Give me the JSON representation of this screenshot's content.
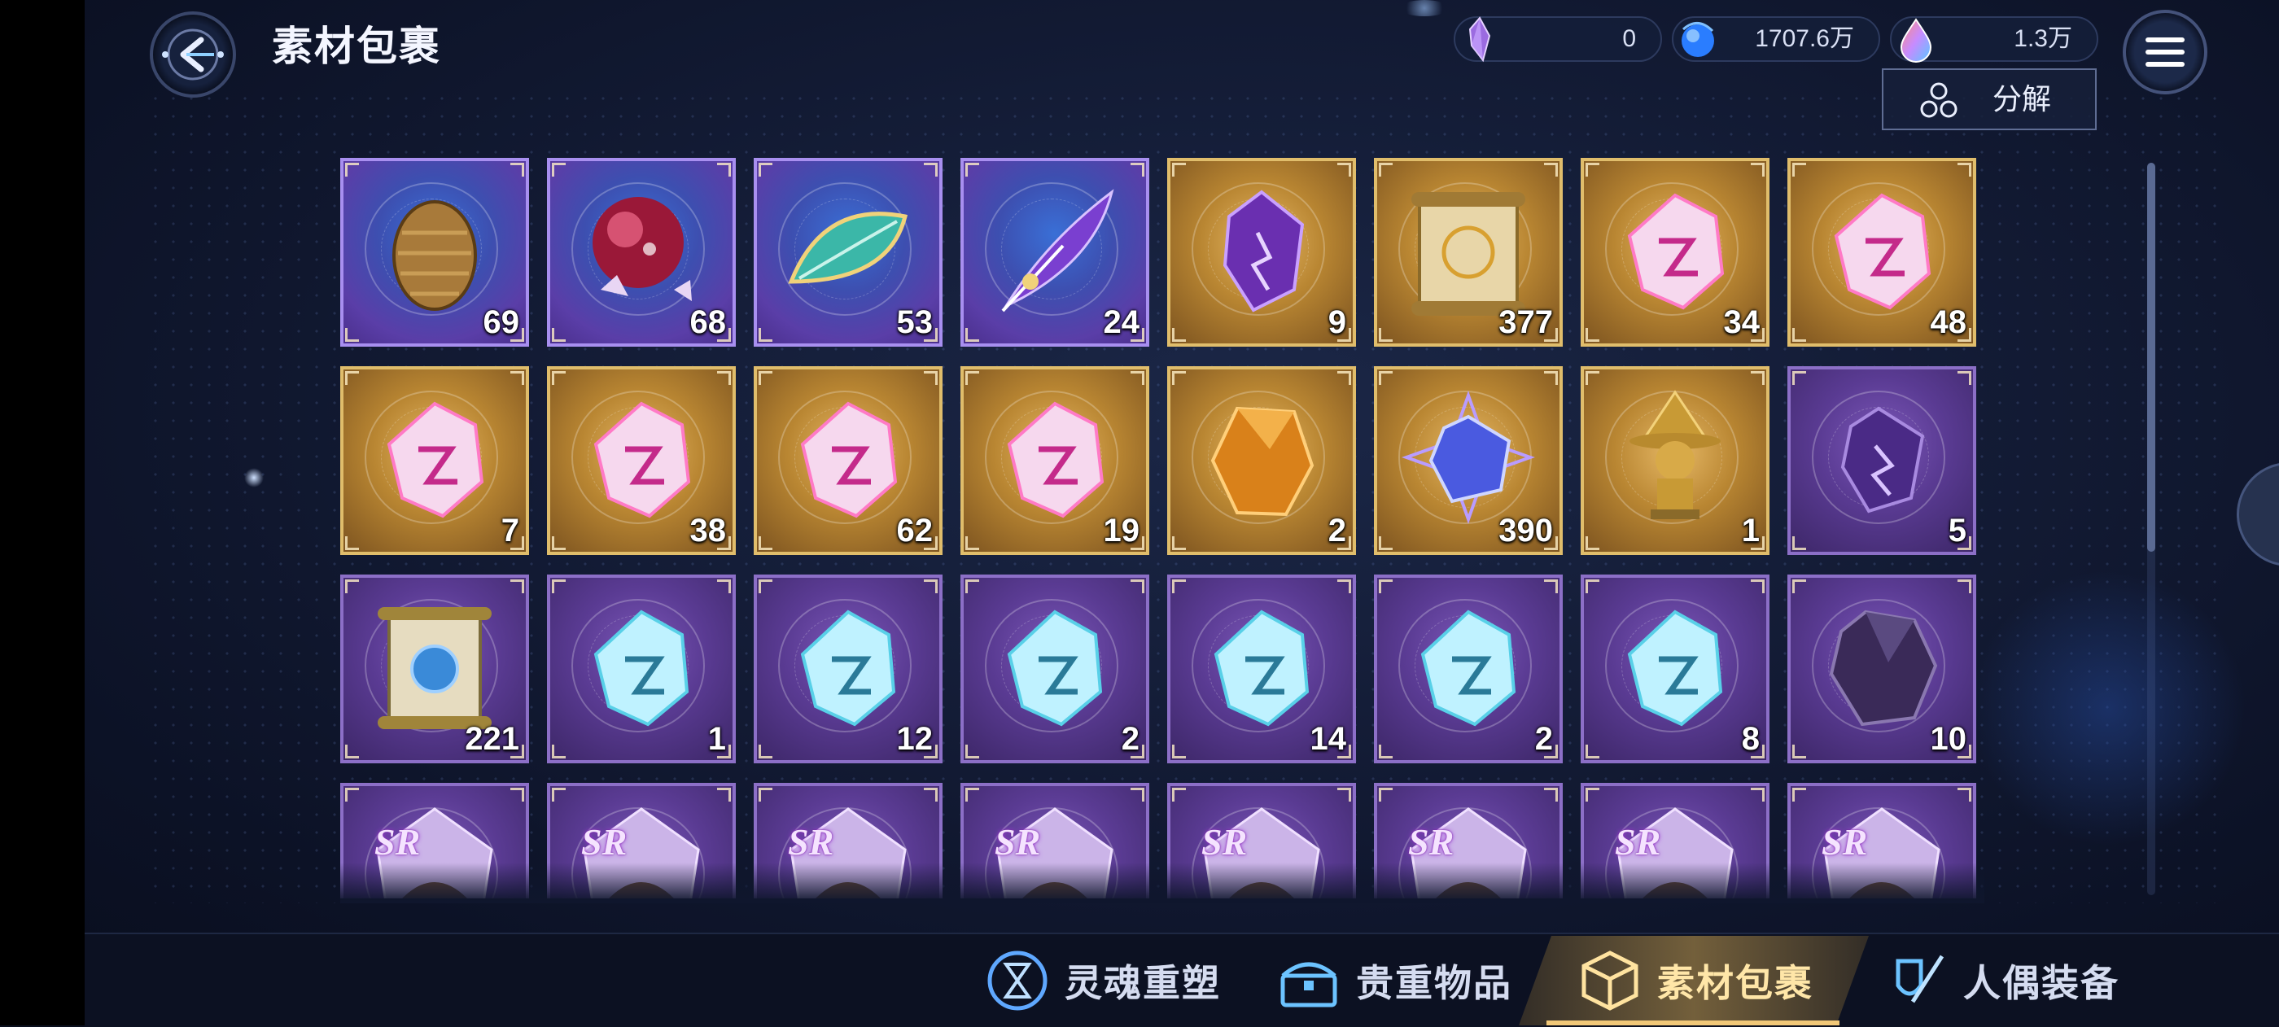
{
  "header": {
    "title": "素材包裹",
    "back_icon": "back-arrow-icon",
    "menu_icon": "hamburger-menu-icon"
  },
  "currencies": [
    {
      "name": "crystal",
      "icon": "purple-crystal-icon",
      "value": "0"
    },
    {
      "name": "blue-orb",
      "icon": "blue-orb-icon",
      "value": "1707.6万"
    },
    {
      "name": "rainbow-drop",
      "icon": "rainbow-drop-icon",
      "value": "1.3万"
    }
  ],
  "decompose_button": {
    "label": "分解",
    "icon": "decompose-icon"
  },
  "items": [
    {
      "icon": "golden-egg-icon",
      "rarity": "blue",
      "count": "69"
    },
    {
      "icon": "red-nebula-orb-icon",
      "rarity": "blue",
      "count": "68"
    },
    {
      "icon": "teal-feather-leaf-icon",
      "rarity": "blue",
      "count": "53"
    },
    {
      "icon": "purple-quill-icon",
      "rarity": "blue",
      "count": "24"
    },
    {
      "icon": "purple-crystal-shard-icon",
      "rarity": "gold",
      "count": "9"
    },
    {
      "icon": "golden-scroll-icon",
      "rarity": "gold",
      "count": "377"
    },
    {
      "icon": "pink-rune-stone-icon",
      "rarity": "gold",
      "count": "34"
    },
    {
      "icon": "pink-rune-stone-icon",
      "rarity": "gold",
      "count": "48"
    },
    {
      "icon": "pink-rune-stone-icon",
      "rarity": "gold",
      "count": "7"
    },
    {
      "icon": "pink-rune-stone-icon",
      "rarity": "gold",
      "count": "38"
    },
    {
      "icon": "pink-rune-stone-icon",
      "rarity": "gold",
      "count": "62"
    },
    {
      "icon": "pink-rune-stone-icon",
      "rarity": "gold",
      "count": "19"
    },
    {
      "icon": "amber-gem-icon",
      "rarity": "gold",
      "count": "2"
    },
    {
      "icon": "blue-star-crystal-icon",
      "rarity": "gold",
      "count": "390"
    },
    {
      "icon": "golden-witch-figurine-icon",
      "rarity": "gold",
      "count": "1"
    },
    {
      "icon": "dark-purple-shard-icon",
      "rarity": "purple",
      "count": "5"
    },
    {
      "icon": "blue-scroll-icon",
      "rarity": "purple",
      "count": "221"
    },
    {
      "icon": "cyan-rune-stone-icon",
      "rarity": "purple",
      "count": "1"
    },
    {
      "icon": "cyan-rune-stone-icon",
      "rarity": "purple",
      "count": "12"
    },
    {
      "icon": "cyan-rune-stone-icon",
      "rarity": "purple",
      "count": "2"
    },
    {
      "icon": "cyan-rune-stone-icon",
      "rarity": "purple",
      "count": "14"
    },
    {
      "icon": "cyan-rune-stone-icon",
      "rarity": "purple",
      "count": "2"
    },
    {
      "icon": "cyan-rune-stone-icon",
      "rarity": "purple",
      "count": "8"
    },
    {
      "icon": "dark-amethyst-icon",
      "rarity": "purple",
      "count": "10"
    },
    {
      "icon": "sr-character-shard-icon",
      "rarity": "purple",
      "tag": "SR",
      "count": ""
    },
    {
      "icon": "sr-character-shard-icon",
      "rarity": "purple",
      "tag": "SR",
      "count": ""
    },
    {
      "icon": "sr-character-shard-icon",
      "rarity": "purple",
      "tag": "SR",
      "count": ""
    },
    {
      "icon": "sr-character-shard-icon",
      "rarity": "purple",
      "tag": "SR",
      "count": ""
    },
    {
      "icon": "sr-character-shard-icon",
      "rarity": "purple",
      "tag": "SR",
      "count": ""
    },
    {
      "icon": "sr-character-shard-icon",
      "rarity": "purple",
      "tag": "SR",
      "count": ""
    },
    {
      "icon": "sr-character-shard-icon",
      "rarity": "purple",
      "tag": "SR",
      "count": ""
    },
    {
      "icon": "sr-character-shard-icon",
      "rarity": "purple",
      "tag": "SR",
      "count": ""
    }
  ],
  "bottom_tabs": [
    {
      "label": "灵魂重塑",
      "icon": "soul-reshape-icon",
      "active": false
    },
    {
      "label": "贵重物品",
      "icon": "treasure-chest-icon",
      "active": false
    },
    {
      "label": "素材包裹",
      "icon": "material-package-icon",
      "active": true
    },
    {
      "label": "人偶装备",
      "icon": "doll-equipment-icon",
      "active": false
    }
  ],
  "colors": {
    "gold_frame": "#e0bd6b",
    "purple_frame": "#8c6fc7",
    "blue_frame": "#a88ff0",
    "active_tab": "#f1c878"
  }
}
